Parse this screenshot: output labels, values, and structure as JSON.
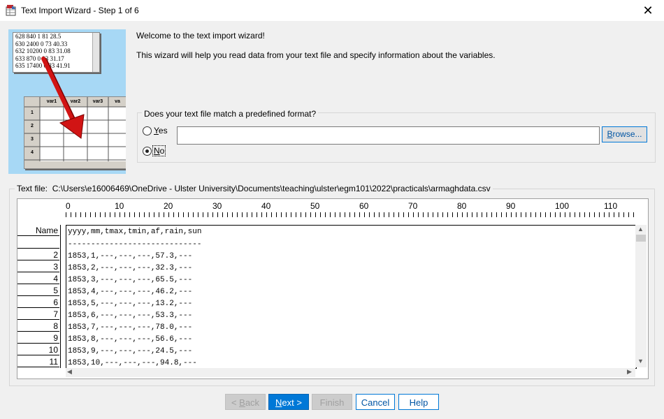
{
  "window": {
    "title": "Text Import Wizard - Step 1 of 6",
    "close_glyph": "✕"
  },
  "illustration": {
    "text_lines": [
      "628 840 1 81 28.5",
      "630 2400 0 73 40.33",
      "632 10200 0 83 31.08",
      "633 870 0 93 31.17",
      "635 17400 0 83 41.91"
    ],
    "grid_headers": [
      "var1",
      "var2",
      "var3",
      "va"
    ],
    "grid_rows": [
      "1",
      "2",
      "3",
      "4"
    ],
    "arrow_color": "#cc1111"
  },
  "welcome": {
    "title": "Welcome to the text import wizard!",
    "description": "This wizard will help you read data from your text file and specify information about the variables."
  },
  "format_group": {
    "question": "Does your text file match a predefined format?",
    "yes_label": "Yes",
    "no_label": "No",
    "selected": "No",
    "format_value": "",
    "browse_label": "Browse..."
  },
  "text_file": {
    "label": "Text file:",
    "path": "C:\\Users\\e16006469\\OneDrive - Ulster University\\Documents\\teaching\\ulster\\egm101\\2022\\practicals\\armaghdata.csv"
  },
  "ruler": [
    "0",
    "10",
    "20",
    "30",
    "40",
    "50",
    "60",
    "70",
    "80",
    "90",
    "100",
    "110"
  ],
  "preview_rows": [
    {
      "name": "Name",
      "text": "yyyy,mm,tmax,tmin,af,rain,sun"
    },
    {
      "name": "",
      "text": "-----------------------------"
    },
    {
      "name": "2",
      "text": "1853,1,---,---,---,57.3,---"
    },
    {
      "name": "3",
      "text": "1853,2,---,---,---,32.3,---"
    },
    {
      "name": "4",
      "text": "1853,3,---,---,---,65.5,---"
    },
    {
      "name": "5",
      "text": "1853,4,---,---,---,46.2,---"
    },
    {
      "name": "6",
      "text": "1853,5,---,---,---,13.2,---"
    },
    {
      "name": "7",
      "text": "1853,6,---,---,---,53.3,---"
    },
    {
      "name": "8",
      "text": "1853,7,---,---,---,78.0,---"
    },
    {
      "name": "9",
      "text": "1853,8,---,---,---,56.6,---"
    },
    {
      "name": "10",
      "text": "1853,9,---,---,---,24.5,---"
    },
    {
      "name": "11",
      "text": "1853,10,---,---,---,94.8,---"
    }
  ],
  "buttons": {
    "back": "< Back",
    "next": "Next >",
    "finish": "Finish",
    "cancel": "Cancel",
    "help": "Help"
  }
}
